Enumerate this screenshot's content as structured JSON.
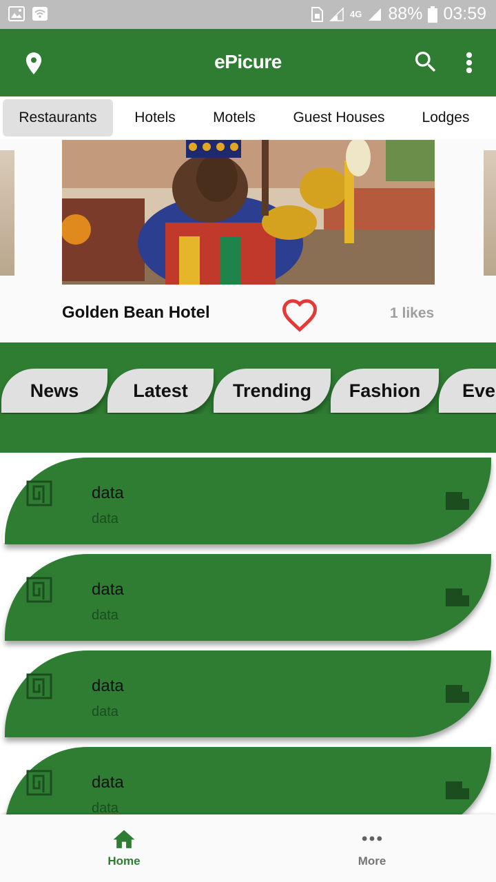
{
  "status_bar": {
    "battery": "88%",
    "time": "03:59",
    "network": "4G"
  },
  "app_bar": {
    "title": "ePicure",
    "icons": [
      "location-icon",
      "search-icon",
      "more-vert-icon"
    ]
  },
  "categories": [
    {
      "label": "Restaurants",
      "active": true
    },
    {
      "label": "Hotels"
    },
    {
      "label": "Motels"
    },
    {
      "label": "Guest Houses"
    },
    {
      "label": "Lodges"
    }
  ],
  "featured": {
    "name": "Golden Bean Hotel",
    "likes": "1 likes"
  },
  "topic_tabs": [
    "News",
    "Latest",
    "Trending",
    "Fashion",
    "Eve"
  ],
  "list": [
    {
      "title": "data",
      "subtitle": "data"
    },
    {
      "title": "data",
      "subtitle": "data"
    },
    {
      "title": "data",
      "subtitle": "data"
    },
    {
      "title": "data",
      "subtitle": "data"
    }
  ],
  "bottom_nav": {
    "home": "Home",
    "more": "More"
  },
  "colors": {
    "primary": "#2e7d32",
    "accent_heart": "#e53935",
    "chip": "#e0e0e0"
  }
}
